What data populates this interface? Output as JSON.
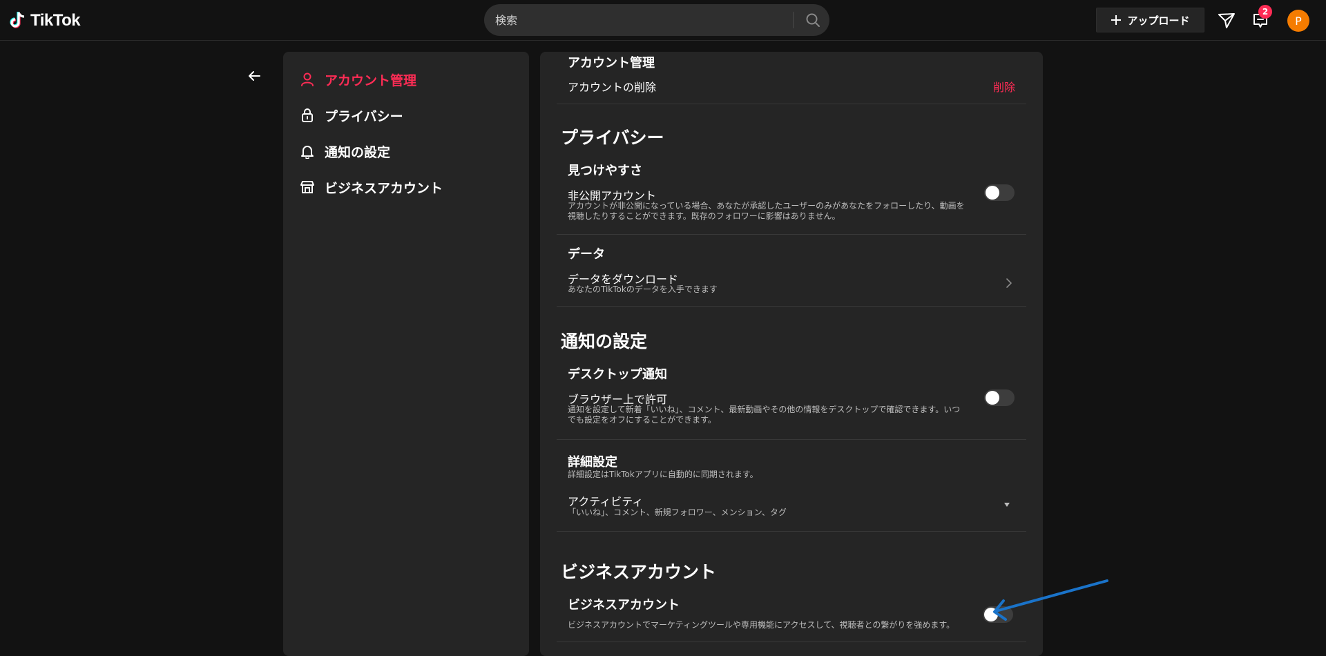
{
  "header": {
    "logo_text": "TikTok",
    "search_placeholder": "検索",
    "upload_label": "アップロード",
    "inbox_badge": "2",
    "avatar_letter": "P"
  },
  "sidebar": {
    "items": [
      {
        "label": "アカウント管理",
        "icon": "user-icon",
        "active": true
      },
      {
        "label": "プライバシー",
        "icon": "lock-icon",
        "active": false
      },
      {
        "label": "通知の設定",
        "icon": "bell-icon",
        "active": false
      },
      {
        "label": "ビジネスアカウント",
        "icon": "shop-icon",
        "active": false
      }
    ]
  },
  "main": {
    "account": {
      "title": "アカウント管理",
      "delete_row_label": "アカウントの削除",
      "delete_action": "削除"
    },
    "privacy": {
      "title": "プライバシー",
      "discoverability_title": "見つけやすさ",
      "private_label": "非公開アカウント",
      "private_desc": "アカウントが非公開になっている場合、あなたが承認したユーザーのみがあなたをフォローしたり、動画を視聴したりすることができます。既存のフォロワーに影響はありません。",
      "private_on": false,
      "data_title": "データ",
      "download_label": "データをダウンロード",
      "download_desc": "あなたのTikTokのデータを入手できます"
    },
    "notifications": {
      "title": "通知の設定",
      "desktop_title": "デスクトップ通知",
      "browser_label": "ブラウザー上で許可",
      "browser_desc": "通知を設定して新着「いいね」、コメント、最新動画やその他の情報をデスクトップで確認できます。いつでも設定をオフにすることができます。",
      "browser_on": false,
      "detail_title": "詳細設定",
      "detail_desc": "詳細設定はTikTokアプリに自動的に同期されます。",
      "activity_label": "アクティビティ",
      "activity_desc": "「いいね」、コメント、新規フォロワー、メンション、タグ"
    },
    "business": {
      "title": "ビジネスアカウント",
      "sub_title": "ビジネスアカウント",
      "desc": "ビジネスアカウントでマーケティングツールや専用機能にアクセスして、視聴者との繋がりを強めます。",
      "on": false
    }
  },
  "colors": {
    "accent": "#fe2c55",
    "background": "#121212",
    "panel": "#252525",
    "annotation_arrow": "#1a73c9"
  }
}
